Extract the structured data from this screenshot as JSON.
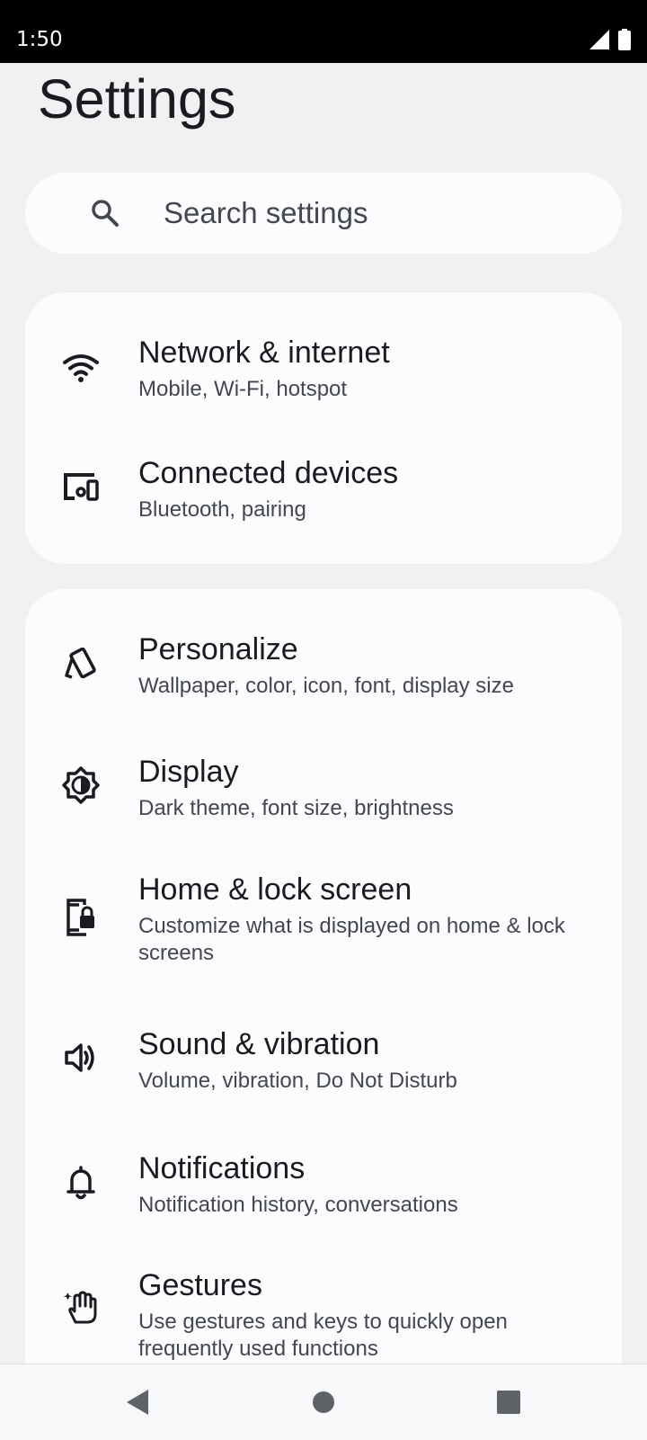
{
  "status_bar": {
    "time": "1:50",
    "icons": [
      "cell-signal-icon",
      "battery-icon"
    ]
  },
  "page": {
    "title": "Settings"
  },
  "search": {
    "placeholder": "Search settings",
    "icon": "search-icon"
  },
  "cards": [
    {
      "items": [
        {
          "title": "Network & internet",
          "subtitle": "Mobile, Wi-Fi, hotspot",
          "icon": "wifi-icon"
        },
        {
          "title": "Connected devices",
          "subtitle": "Bluetooth, pairing",
          "icon": "connected-devices-icon"
        }
      ]
    },
    {
      "items": [
        {
          "title": "Personalize",
          "subtitle": "Wallpaper, color, icon, font, display size",
          "icon": "personalize-icon"
        },
        {
          "title": "Display",
          "subtitle": "Dark theme, font size, brightness",
          "icon": "brightness-icon"
        },
        {
          "title": "Home & lock screen",
          "subtitle": "Customize what is displayed on home & lock screens",
          "icon": "phone-lock-icon"
        },
        {
          "title": "Sound & vibration",
          "subtitle": "Volume, vibration, Do Not Disturb",
          "icon": "speaker-icon"
        },
        {
          "title": "Notifications",
          "subtitle": "Notification history, conversations",
          "icon": "bell-icon"
        },
        {
          "title": "Gestures",
          "subtitle": "Use gestures and keys to quickly open frequently used functions",
          "icon": "gesture-hand-icon"
        }
      ]
    }
  ],
  "nav_bar": {
    "buttons": [
      "back-icon",
      "home-icon",
      "recents-icon"
    ]
  },
  "colors": {
    "background": "#f0f1f3",
    "card": "#fbfcfe",
    "text_primary": "#1b1b1f",
    "text_secondary": "#44474e",
    "status_bar": "#000000"
  }
}
